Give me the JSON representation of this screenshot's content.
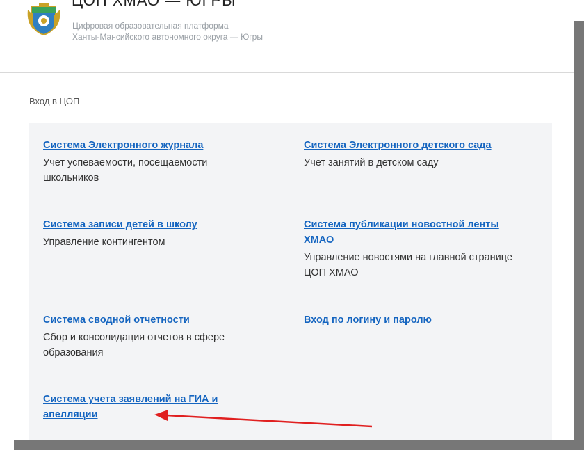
{
  "header": {
    "title": "ЦОП ХМАО — ЮГРЫ",
    "subtitle_line1": "Цифровая образовательная платформа",
    "subtitle_line2": "Ханты-Мансийского автономного округа — Югры"
  },
  "section": {
    "title": "Вход в ЦОП"
  },
  "systems": [
    {
      "link": "Система Электронного журнала",
      "desc": "Учет успеваемости, посещаемости школьников"
    },
    {
      "link": "Система Электронного детского сада",
      "desc": "Учет занятий в детском саду"
    },
    {
      "link": "Система записи детей в школу",
      "desc": "Управление контингентом"
    },
    {
      "link": "Система публикации новостной ленты ХМАО",
      "desc": "Управление новостями на главной странице ЦОП ХМАО"
    },
    {
      "link": "Система сводной отчетности",
      "desc": "Сбор и консолидация отчетов в сфере образования"
    },
    {
      "link": "Вход по логину и паролю",
      "desc": ""
    },
    {
      "link": "Система учета заявлений на ГИА и апелляции",
      "desc": ""
    }
  ],
  "colors": {
    "link": "#1565c0",
    "panel": "#f3f4f6",
    "arrow": "#e02020"
  },
  "icons": {
    "logo": "coat-of-arms-icon",
    "annotation": "red-arrow-icon"
  }
}
